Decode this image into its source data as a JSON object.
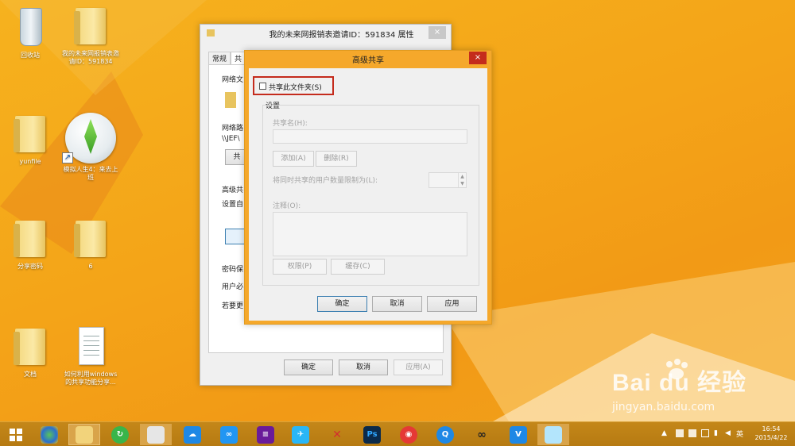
{
  "desktop": {
    "icons": [
      {
        "label": "回收站"
      },
      {
        "label": "我的未来网报销表邀请ID：591834"
      },
      {
        "label": "yunfile"
      },
      {
        "label": "模拟人生4：来去上班"
      },
      {
        "label": "分享密码"
      },
      {
        "label": "6"
      },
      {
        "label": "文档"
      },
      {
        "label": "如何利用windows的共享功能分享..."
      }
    ]
  },
  "properties_window": {
    "title": "我的未来网报销表邀请ID：591834 属性",
    "close_label": "×",
    "tabs": [
      {
        "label": "常规"
      },
      {
        "label": "共"
      }
    ],
    "net_share_label": "网络文",
    "net_path_label": "网络路",
    "path_value": "\\\\JEF\\",
    "share_button": "共",
    "advanced_label": "高级共",
    "set_label": "设置自",
    "pwd_label": "密码保",
    "user_label": "用户必",
    "ifchange_label": "若要更",
    "ok": "确定",
    "cancel": "取消",
    "apply": "应用(A)"
  },
  "advanced_dialog": {
    "title": "高级共享",
    "close_label": "×",
    "share_checkbox_label": "共享此文件夹(S)",
    "settings_group": "设置",
    "share_name_label": "共享名(H):",
    "add_button": "添加(A)",
    "delete_button": "删除(R)",
    "limit_label": "将同时共享的用户数量限制为(L):",
    "comment_label": "注释(O):",
    "permissions_button": "权限(P)",
    "cache_button": "缓存(C)",
    "ok": "确定",
    "cancel": "取消",
    "apply": "应用"
  },
  "taskbar": {
    "ime": "英",
    "time": "16:54",
    "date": "2015/4/22",
    "apps": [
      {
        "icon": "windows-icon"
      },
      {
        "icon": "media-center-icon"
      },
      {
        "icon": "file-explorer-icon"
      },
      {
        "icon": "green-refresh-icon"
      },
      {
        "icon": "paint-icon"
      },
      {
        "icon": "cloud-icon"
      },
      {
        "icon": "baidu-cloud-icon"
      },
      {
        "icon": "book-icon"
      },
      {
        "icon": "bird-icon"
      },
      {
        "icon": "x-icon"
      },
      {
        "icon": "photoshop-icon",
        "text": "Ps"
      },
      {
        "icon": "cow-icon"
      },
      {
        "icon": "qq-icon"
      },
      {
        "icon": "binoculars-icon"
      },
      {
        "icon": "v-app-icon",
        "text": "V"
      },
      {
        "icon": "notebook-icon"
      }
    ]
  },
  "watermark": {
    "brand": "Bai du 经验",
    "url": "jingyan.baidu.com"
  },
  "colors": {
    "accent_red": "#c42b1c",
    "dialog_border": "#e6a52a",
    "taskbar": "#b67a12"
  }
}
